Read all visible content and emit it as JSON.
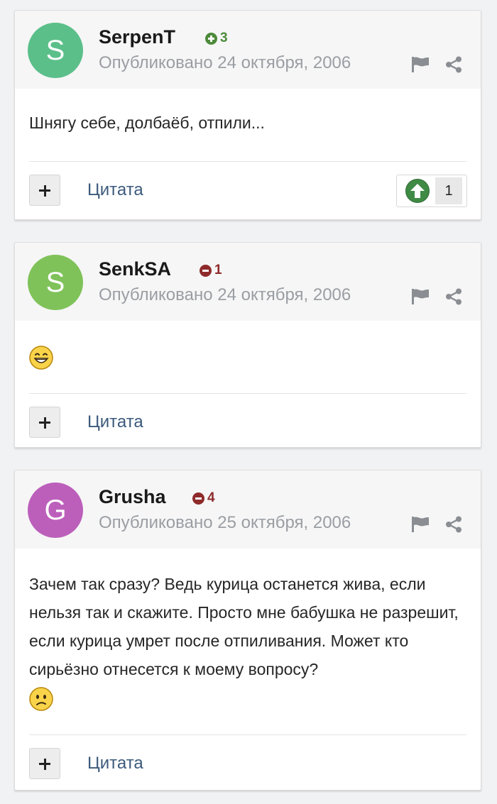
{
  "posts": [
    {
      "author": "SerpenT",
      "avatar_letter": "S",
      "avatar_color": "#5bbf8a",
      "reputation": "3",
      "reputation_type": "positive",
      "posted": "Опубликовано 24 октября, 2006",
      "content": "Шнягу себе, долбаёб, отпили...",
      "quote_label": "Цитата",
      "reaction_count": "1"
    },
    {
      "author": "SenkSA",
      "avatar_letter": "S",
      "avatar_color": "#7fc25a",
      "reputation": "1",
      "reputation_type": "negative",
      "posted": "Опубликовано 24 октября, 2006",
      "content_emoji": "grin-emoji",
      "quote_label": "Цитата"
    },
    {
      "author": "Grusha",
      "avatar_letter": "G",
      "avatar_color": "#bc5fbb",
      "reputation": "4",
      "reputation_type": "negative",
      "posted": "Опубликовано 25 октября, 2006",
      "content": "Зачем так сразу? Ведь курица останется жива, если нельзя так и скажите. Просто мне бабушка не разрешит, если курица умрет после отпиливания. Может кто сирьёзно отнесется к моему вопросу?",
      "content_emoji": "sad-emoji",
      "quote_label": "Цитата"
    }
  ]
}
